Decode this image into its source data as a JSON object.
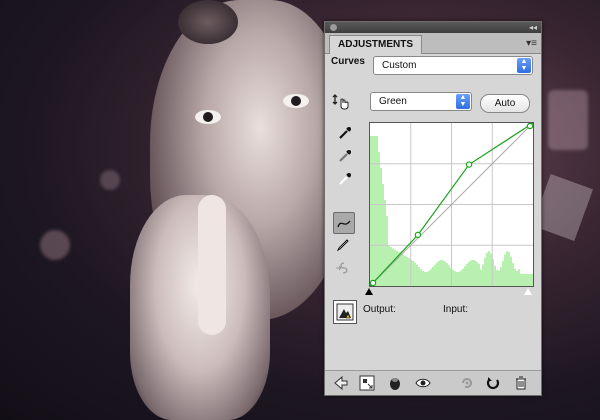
{
  "panel": {
    "tab_label": "ADJUSTMENTS",
    "adjustment_name": "Curves",
    "preset_value": "Custom",
    "channel_value": "Green",
    "auto_label": "Auto",
    "output_label": "Output:",
    "input_label": "Input:"
  },
  "colors": {
    "curve": "#1aa31a",
    "histogram": "#b8f0b0",
    "select_arrow": "#2f6ee0"
  },
  "curve": {
    "points": [
      [
        0,
        0
      ],
      [
        75,
        80
      ],
      [
        155,
        190
      ],
      [
        255,
        255
      ]
    ]
  }
}
